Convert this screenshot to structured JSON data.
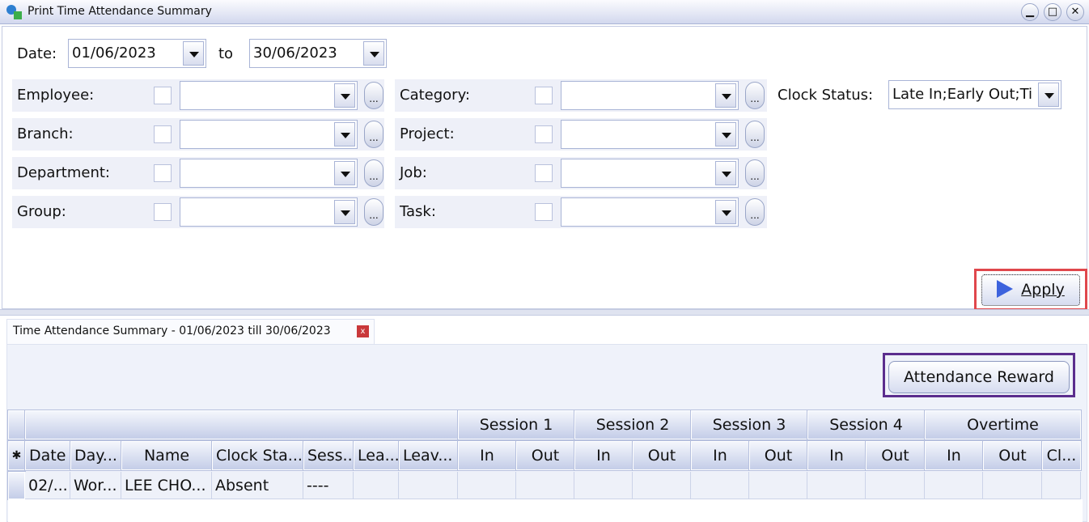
{
  "window": {
    "title": "Print Time Attendance Summary",
    "minimize": "▁",
    "maximize": "□",
    "close": "✕"
  },
  "date": {
    "label": "Date:",
    "from": "01/06/2023",
    "to_label": "to",
    "to": "30/06/2023"
  },
  "filters_left": [
    {
      "label": "Employee:"
    },
    {
      "label": "Branch:"
    },
    {
      "label": "Department:"
    },
    {
      "label": "Group:"
    }
  ],
  "filters_right": [
    {
      "label": "Category:"
    },
    {
      "label": "Project:"
    },
    {
      "label": "Job:"
    },
    {
      "label": "Task:"
    }
  ],
  "clock_status": {
    "label": "Clock Status:",
    "value": "Late In;Early Out;Ti"
  },
  "ellipsis": "...",
  "apply_label": "Apply",
  "tab": {
    "label": "Time Attendance Summary - 01/06/2023 till 30/06/2023",
    "close": "x"
  },
  "reward_label": "Attendance Reward",
  "grid": {
    "groups": [
      "Session 1",
      "Session 2",
      "Session 3",
      "Session 4",
      "Overtime"
    ],
    "new_row_marker": "✱",
    "columns": [
      "Date",
      "Day...",
      "Name",
      "Clock Sta...",
      "Sess...",
      "Lea...",
      "Leav...",
      "In",
      "Out",
      "In",
      "Out",
      "In",
      "Out",
      "In",
      "Out",
      "In",
      "Out",
      "Cl..."
    ],
    "rows": [
      [
        "02/...",
        "Wor...",
        "LEE CHO...",
        "Absent",
        "----",
        "",
        "",
        "",
        "",
        "",
        "",
        "",
        "",
        "",
        "",
        "",
        "",
        ""
      ]
    ]
  },
  "colors": {
    "highlight_apply": "#e0474c",
    "highlight_reward": "#5b2d8e",
    "apply_icon": "#3d63dd"
  }
}
